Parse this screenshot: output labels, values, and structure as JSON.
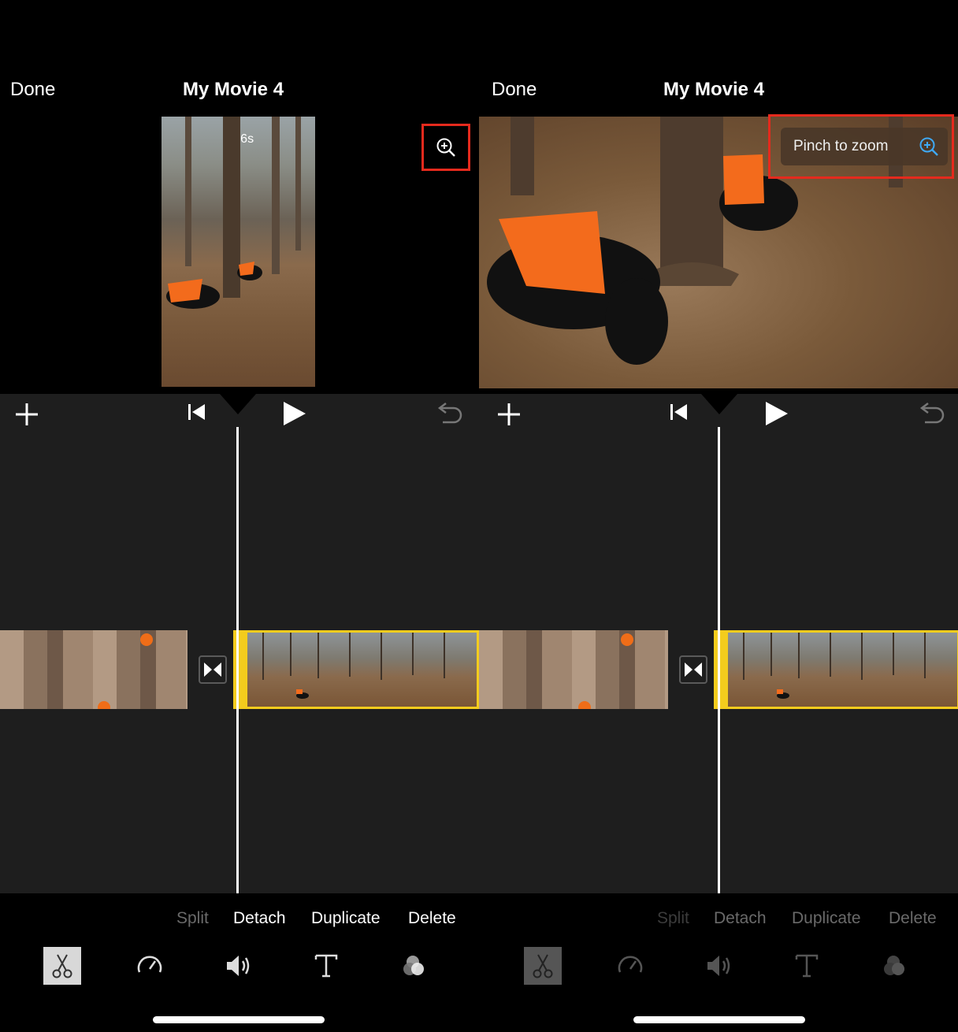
{
  "left_panel": {
    "nav": {
      "done_label": "Done",
      "title": "My Movie 4"
    },
    "preview": {
      "duration": "27.6s"
    },
    "actions": [
      {
        "label": "Split",
        "color": "#6a6a6a"
      },
      {
        "label": "Detach",
        "color": "#ffffff"
      },
      {
        "label": "Duplicate",
        "color": "#ffffff"
      },
      {
        "label": "Delete",
        "color": "#ffffff"
      }
    ]
  },
  "right_panel": {
    "nav": {
      "done_label": "Done",
      "title": "My Movie 4"
    },
    "pinch_tooltip": "Pinch to zoom",
    "actions": [
      {
        "label": "Split",
        "color": "#3c3c3c"
      },
      {
        "label": "Detach",
        "color": "#6a6a6a"
      },
      {
        "label": "Duplicate",
        "color": "#6a6a6a"
      },
      {
        "label": "Delete",
        "color": "#6a6a6a"
      }
    ]
  },
  "colors": {
    "highlight": "#e52a1d",
    "clip_selected": "#f3cc1d",
    "zoom_icon_right": "#3fa9f5"
  },
  "icons": [
    "add-icon",
    "skip-back-icon",
    "play-icon",
    "undo-icon",
    "transition-icon",
    "zoom-icon",
    "scissors-icon",
    "speed-icon",
    "volume-icon",
    "text-icon",
    "filters-icon"
  ]
}
